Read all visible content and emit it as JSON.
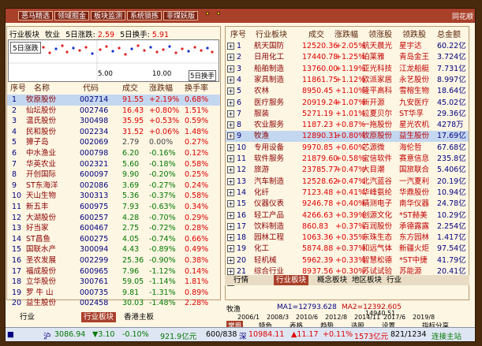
{
  "toolbar": {
    "buttons": [
      "恶马精选",
      "领域掘金",
      "板块监测",
      "系统锁拣",
      "非煤妖版"
    ],
    "logo": "同花顺"
  },
  "left_panel": {
    "title": "行业板块",
    "sector": "牧业",
    "info1": "5日涨跌:",
    "info1_val": "2.59",
    "info2": "5日换手:",
    "info2_val": "5.91",
    "chart_label": "5日涨跌",
    "axis_left": "5.00",
    "axis_mid": "10.00",
    "axis_right": "5日换手",
    "headers": [
      "序号",
      "名称",
      "代码",
      "成交",
      "涨跌幅",
      "换手率"
    ],
    "rows": [
      {
        "n": "1",
        "name": "牧原股份",
        "code": "002714",
        "price": "91.55",
        "chg": "+2.19%",
        "turn": "0.68%",
        "dir": "up"
      },
      {
        "n": "2",
        "name": "仙坛股份",
        "code": "002746",
        "price": "16.43",
        "chg": "+0.80%",
        "turn": "1.51%",
        "dir": "up"
      },
      {
        "n": "3",
        "name": "温氏股份",
        "code": "300498",
        "price": "35.95",
        "chg": "+0.53%",
        "turn": "0.59%",
        "dir": "up"
      },
      {
        "n": "4",
        "name": "民和股份",
        "code": "002234",
        "price": "31.52",
        "chg": "+0.06%",
        "turn": "1.48%",
        "dir": "up"
      },
      {
        "n": "5",
        "name": "獐子岛",
        "code": "002069",
        "price": "2.79",
        "chg": "0.00%",
        "turn": "0.27%",
        "dir": "zr"
      },
      {
        "n": "6",
        "name": "中水渔业",
        "code": "000798",
        "price": "6.20",
        "chg": "-0.16%",
        "turn": "0.12%",
        "dir": "dn"
      },
      {
        "n": "7",
        "name": "华英农业",
        "code": "002321",
        "price": "5.60",
        "chg": "-0.18%",
        "turn": "0.58%",
        "dir": "dn"
      },
      {
        "n": "8",
        "name": "开创国际",
        "code": "600097",
        "price": "9.90",
        "chg": "-0.20%",
        "turn": "0.25%",
        "dir": "dn"
      },
      {
        "n": "9",
        "name": "ST东海洋",
        "code": "002086",
        "price": "3.69",
        "chg": "-0.27%",
        "turn": "0.24%",
        "dir": "dn"
      },
      {
        "n": "10",
        "name": "天山生物",
        "code": "300313",
        "price": "5.36",
        "chg": "-0.37%",
        "turn": "0.58%",
        "dir": "dn"
      },
      {
        "n": "11",
        "name": "新五丰",
        "code": "600975",
        "price": "7.93",
        "chg": "-0.63%",
        "turn": "0.34%",
        "dir": "dn"
      },
      {
        "n": "12",
        "name": "大湖股份",
        "code": "600257",
        "price": "4.28",
        "chg": "-0.70%",
        "turn": "0.29%",
        "dir": "dn"
      },
      {
        "n": "13",
        "name": "好当家",
        "code": "600467",
        "price": "2.75",
        "chg": "-0.72%",
        "turn": "0.28%",
        "dir": "dn"
      },
      {
        "n": "14",
        "name": "ST昌鱼",
        "code": "600275",
        "price": "4.05",
        "chg": "-0.74%",
        "turn": "0.66%",
        "dir": "dn"
      },
      {
        "n": "15",
        "name": "国联水产",
        "code": "300094",
        "price": "4.43",
        "chg": "-0.89%",
        "turn": "0.49%",
        "dir": "dn"
      },
      {
        "n": "16",
        "name": "圣农发展",
        "code": "002299",
        "price": "25.36",
        "chg": "-0.90%",
        "turn": "0.38%",
        "dir": "dn"
      },
      {
        "n": "17",
        "name": "福成股份",
        "code": "600965",
        "price": "7.96",
        "chg": "-1.12%",
        "turn": "0.14%",
        "dir": "dn"
      },
      {
        "n": "18",
        "name": "立华股份",
        "code": "300761",
        "price": "59.05",
        "chg": "-1.14%",
        "turn": "1.81%",
        "dir": "dn"
      },
      {
        "n": "19",
        "name": "罗 牛 山",
        "code": "000735",
        "price": "9.81",
        "chg": "-1.31%",
        "turn": "0.89%",
        "dir": "dn"
      },
      {
        "n": "20",
        "name": "益生股份",
        "code": "002458",
        "price": "30.03",
        "chg": "-1.48%",
        "turn": "2.28%",
        "dir": "dn"
      }
    ],
    "bottom_tabs": [
      "行业",
      "行业板块",
      "香港主板"
    ]
  },
  "right_panel": {
    "headers": [
      "序号",
      "行业板块",
      "成交",
      "涨跌幅",
      "领涨股",
      "领跌股",
      "总金额"
    ],
    "rows": [
      {
        "n": "1",
        "name": "航天国防",
        "price": "12520.36",
        "chg": "+2.05%",
        "lead": "航天晨光",
        "lag": "星宇达",
        "amt": "60.22亿",
        "dir": "up"
      },
      {
        "n": "2",
        "name": "日用化工",
        "price": "17440.78",
        "chg": "+1.25%",
        "lead": "珀莱雅",
        "lag": "青岛金王",
        "amt": "3.724亿",
        "dir": "up"
      },
      {
        "n": "3",
        "name": "船舶制造",
        "price": "13760.00",
        "chg": "+1.19%",
        "lead": "亚光科技",
        "lag": "江龙船艇",
        "amt": "7.731亿",
        "dir": "up"
      },
      {
        "n": "4",
        "name": "家具制造",
        "price": "11861.75",
        "chg": "+1.12%",
        "lead": "欧派家居",
        "lag": "永艺股份",
        "amt": "8.997亿",
        "dir": "up"
      },
      {
        "n": "5",
        "name": "农林",
        "price": "8950.45",
        "chg": "+1.10%",
        "lead": "隆平高科",
        "lag": "雪榕生物",
        "amt": "18.64亿",
        "dir": "up"
      },
      {
        "n": "6",
        "name": "医疗服务",
        "price": "20919.24",
        "chg": "+1.07%",
        "lead": "新开源",
        "lag": "九安医疗",
        "amt": "45.02亿",
        "dir": "up"
      },
      {
        "n": "7",
        "name": "服装",
        "price": "5271.19",
        "chg": "+1.01%",
        "lead": "拉夏贝尔",
        "lag": "ST华孚",
        "amt": "29.36亿",
        "dir": "up"
      },
      {
        "n": "8",
        "name": "农业服务",
        "price": "1187.23",
        "chg": "+0.87%",
        "lead": "一拖股份",
        "lag": "星光农机",
        "amt": "4278万",
        "dir": "up"
      },
      {
        "n": "9",
        "name": "牧渔",
        "price": "12890.31",
        "chg": "+0.80%",
        "lead": "牧原股份",
        "lag": "益生股份",
        "amt": "17.69亿",
        "dir": "up",
        "sel": true
      },
      {
        "n": "10",
        "name": "专用设备",
        "price": "9970.85",
        "chg": "+0.60%",
        "lead": "芯源微",
        "lag": "海伦哲",
        "amt": "67.68亿",
        "dir": "up"
      },
      {
        "n": "11",
        "name": "软件服务",
        "price": "21879.60",
        "chg": "+0.58%",
        "lead": "宝信软件",
        "lag": "赛意信息",
        "amt": "235.8亿",
        "dir": "up"
      },
      {
        "n": "12",
        "name": "旅游",
        "price": "23785.77",
        "chg": "+0.47%",
        "lead": "大目潮",
        "lag": "国旅联合",
        "amt": "5.406亿",
        "dir": "up"
      },
      {
        "n": "13",
        "name": "汽车制造",
        "price": "12528.62",
        "chg": "+0.47%",
        "lead": "北汽蓝谷",
        "lag": "一汽夏利",
        "amt": "20.19亿",
        "dir": "up"
      },
      {
        "n": "14",
        "name": "化纤",
        "price": "7123.48",
        "chg": "+0.41%",
        "lead": "华峰氨纶",
        "lag": "华鼎股份",
        "amt": "10.94亿",
        "dir": "up"
      },
      {
        "n": "15",
        "name": "仪器仪表",
        "price": "9246.78",
        "chg": "+0.40%",
        "lead": "精测电子",
        "lag": "南华仪器",
        "amt": "24.78亿",
        "dir": "up"
      },
      {
        "n": "16",
        "name": "轻工产品",
        "price": "4266.63",
        "chg": "+0.39%",
        "lead": "创源文化",
        "lag": "*ST赫美",
        "amt": "10.29亿",
        "dir": "up"
      },
      {
        "n": "17",
        "name": "饮料制造",
        "price": "860.83",
        "chg": "+0.37%",
        "lead": "百润股份",
        "lag": "承德露露",
        "amt": "2.254亿",
        "dir": "up"
      },
      {
        "n": "18",
        "name": "园林工程",
        "price": "1063.36",
        "chg": "+0.35%",
        "lead": "东珠生态",
        "lag": "东方园林",
        "amt": "1.417亿",
        "dir": "up"
      },
      {
        "n": "19",
        "name": "化工",
        "price": "5874.88",
        "chg": "+0.37%",
        "lead": "和远气体",
        "lag": "新疆火炬",
        "amt": "97.54亿",
        "dir": "up"
      },
      {
        "n": "20",
        "name": "轻机械",
        "price": "5962.39",
        "chg": "+0.33%",
        "lead": "智慧松德",
        "lag": "*ST中捷",
        "amt": "41.79亿",
        "dir": "up"
      },
      {
        "n": "21",
        "name": "综合行业",
        "price": "8937.56",
        "chg": "+0.30%",
        "lead": "苏试试验",
        "lag": "苏能源",
        "amt": "20.41亿",
        "dir": "up"
      },
      {
        "n": "22",
        "name": "汽车配件",
        "price": "1278.66",
        "chg": "+0.30%",
        "lead": "京威股份",
        "lag": "金鸿股份",
        "amt": "68.92亿",
        "dir": "up"
      }
    ],
    "bottom_tabs": [
      "行情",
      "行业板块",
      "概念板块",
      "地区板块",
      "行业"
    ]
  },
  "nav": {
    "label": "牧渔",
    "ma1": "MA1=12793.628",
    "ma2": "MA2=12392.605",
    "mini_value": "14940.51",
    "years": [
      "2006/1",
      "2008/3",
      "2010/6",
      "2012/8",
      "2014/11",
      "2017/6",
      "2019/8"
    ],
    "row2": [
      "常用",
      "特色",
      "表格",
      "趋势",
      "选股",
      "设置"
    ],
    "row2_extra": "指标分享"
  },
  "status": {
    "left_label": "沪",
    "left_val": "3086.94",
    "left_chg": "▼3.10",
    "left_pct": "-0.10%",
    "left_amt": "921.9亿元",
    "left_ratio": "600/838",
    "mid_label": "深",
    "mid_val": "10984.11",
    "mid_chg": "▲11.17",
    "mid_pct": "+0.11%",
    "mid_amt": "1573亿元",
    "mid_ratio": "821/1234",
    "right": "连接主站"
  }
}
